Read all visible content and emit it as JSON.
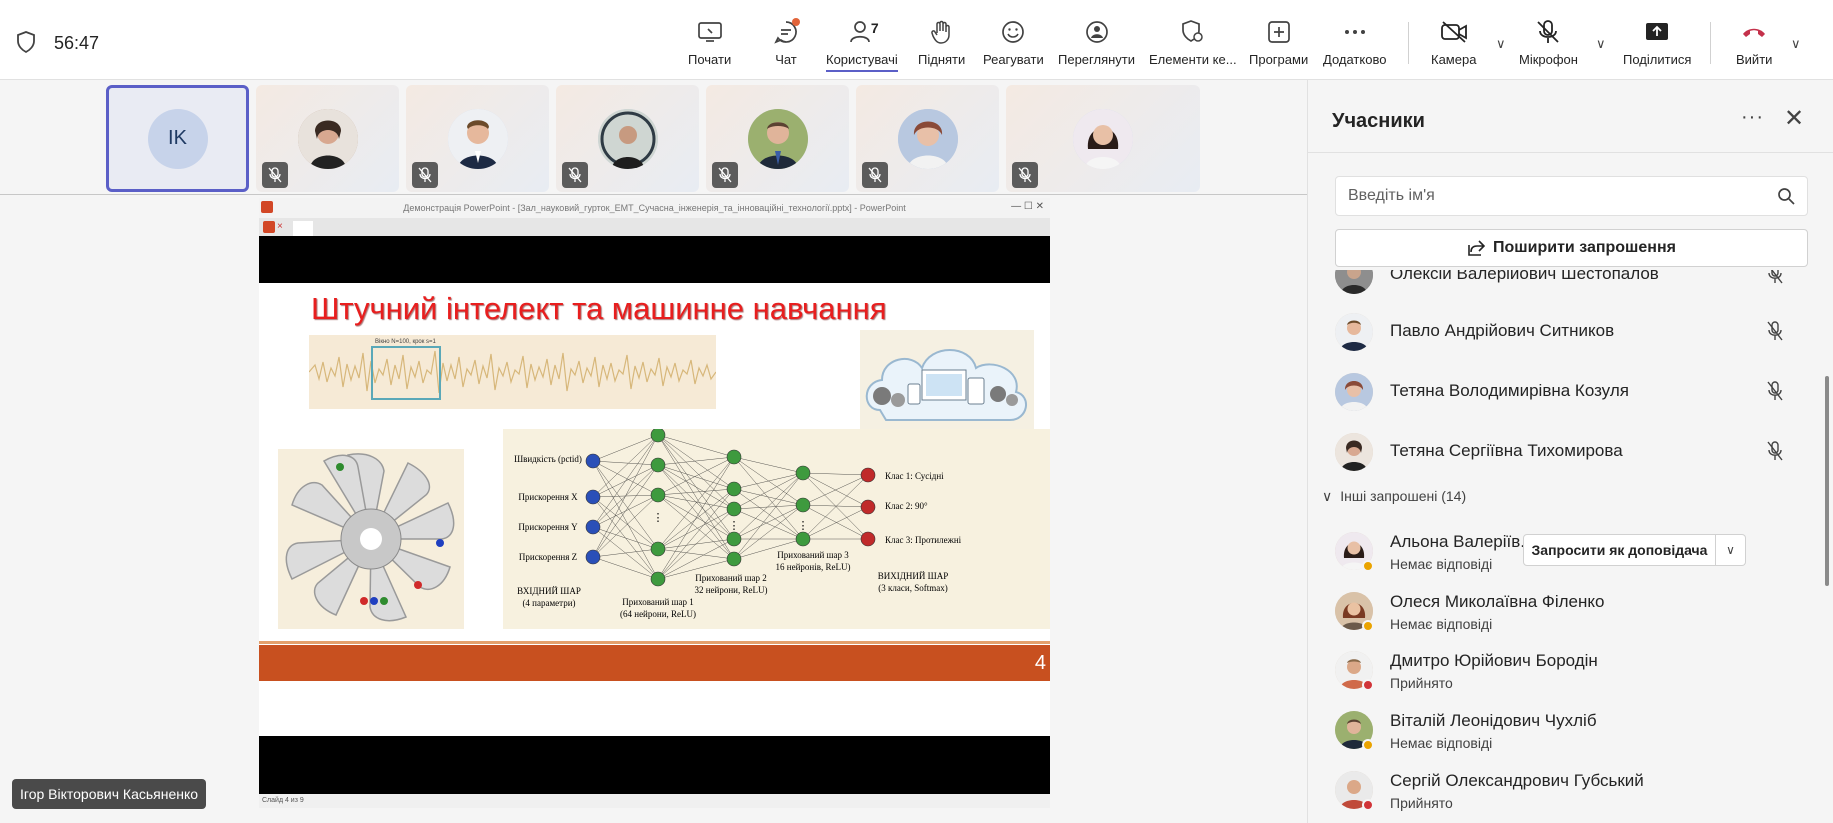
{
  "topbar": {
    "timer": "56:47",
    "buttons": {
      "start": "Почати",
      "chat": "Чат",
      "users": "Користувачі",
      "users_count": "7",
      "raise": "Підняти",
      "react": "Реагувати",
      "view": "Переглянути",
      "elements": "Елементи ке...",
      "apps": "Програми",
      "more": "Додатково",
      "camera": "Камера",
      "mic": "Мікрофон",
      "share": "Поділитися",
      "leave": "Вийти"
    },
    "colors": {
      "accent": "#5b5fc7",
      "leave": "#c4314b",
      "notify": "#e2643a"
    }
  },
  "stage": {
    "self_initials": "IK",
    "presenter_name": "Ігор Вікторович Касьяненко"
  },
  "ppt": {
    "window_title": "Демонстрація PowerPoint - [Зал_науковий_гурток_ЕМТ_Сучасна_інженерія_та_інноваційні_технології.pptx] - PowerPoint",
    "tab_close": "×",
    "slide_title": "Штучний інтелект та машинне навчання",
    "wave_caption": "Вікно N=100, крок s=1",
    "slide_number": "4",
    "status": "Слайд 4 из 9",
    "nn": {
      "inputs": [
        "Швидкість (pctid)",
        "Прискорення X",
        "Прискорення Y",
        "Прискорення Z"
      ],
      "outputs": [
        "Клас 1: Сусідні",
        "Клас 2: 90°",
        "Клас 3: Протилежні"
      ],
      "input_layer": "ВХІДНИЙ ШАР",
      "input_layer_sub": "(4 параметри)",
      "h1": "Прихований шар 1",
      "h1_sub": "(64 нейрони, ReLU)",
      "h2": "Прихований шар 2",
      "h2_sub": "32 нейрони, ReLU)",
      "h3": "Прихований шар 3",
      "h3_sub": "16 нейронів, ReLU)",
      "output_layer": "ВИХІДНИЙ ШАР",
      "output_layer_sub": "(3 класи, Softmax)",
      "dots": "⋮"
    }
  },
  "panel": {
    "title": "Учасники",
    "search_placeholder": "Введіть ім'я",
    "share_invite": "Поширити запрошення",
    "group_invited": "Інші запрошені (14)",
    "invite_as_presenter": "Запросити як доповідача",
    "participants": [
      {
        "name": "Олексій Валерійович Шестопалов",
        "status": ""
      },
      {
        "name": "Павло Андрійович Ситников",
        "status": ""
      },
      {
        "name": "Тетяна Володимирівна Козуля",
        "status": ""
      },
      {
        "name": "Тетяна Сергіївна Тихомирова",
        "status": ""
      }
    ],
    "invited": [
      {
        "name": "Альона Валеріїв...",
        "status": "Немає відповіді"
      },
      {
        "name": "Олеся Миколаївна Філенко",
        "status": "Немає відповіді"
      },
      {
        "name": "Дмитро Юрійович Бородін",
        "status": "Прийнято"
      },
      {
        "name": "Віталій Леонідович Чухліб",
        "status": "Немає відповіді"
      },
      {
        "name": "Сергій Олександрович Губський",
        "status": "Прийнято"
      }
    ],
    "status_colors": {
      "no_answer": "#eaa300",
      "accepted": "#d13438"
    }
  }
}
